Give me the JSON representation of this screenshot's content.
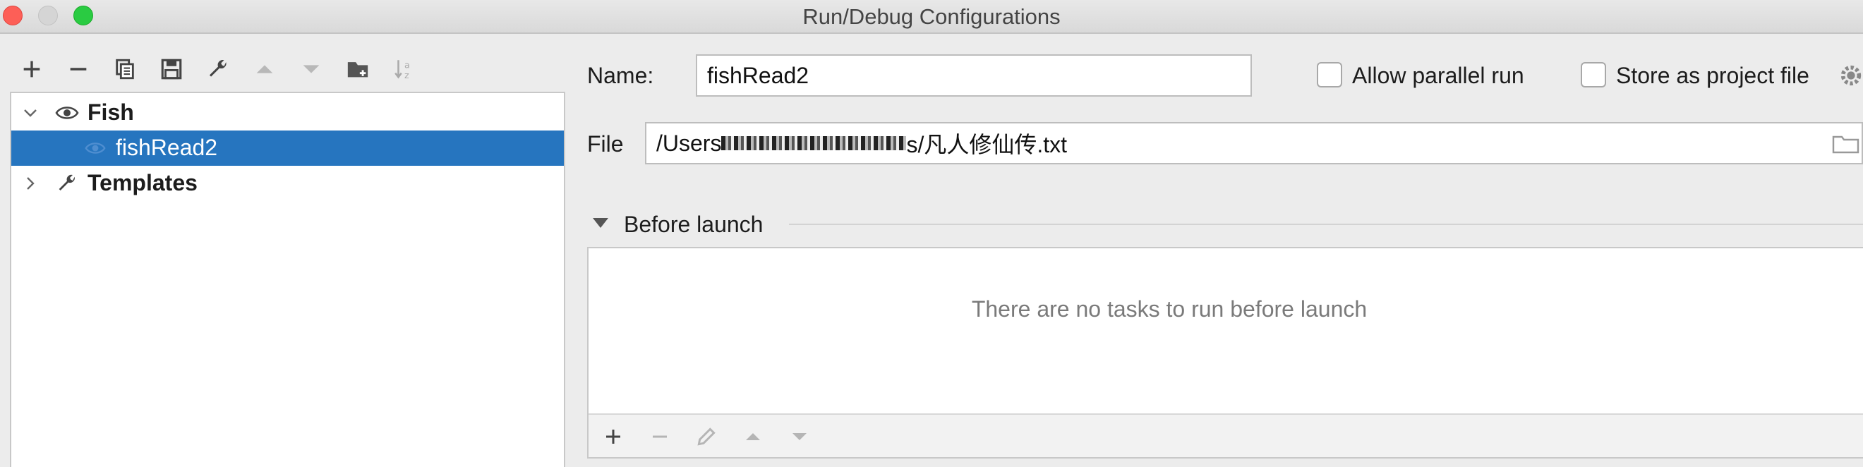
{
  "window": {
    "title": "Run/Debug Configurations"
  },
  "toolbar": {
    "buttons": [
      {
        "name": "add",
        "icon": "plus-icon"
      },
      {
        "name": "remove",
        "icon": "minus-icon"
      },
      {
        "name": "copy",
        "icon": "copy-icon"
      },
      {
        "name": "save",
        "icon": "save-icon"
      },
      {
        "name": "edit-templates",
        "icon": "wrench-icon"
      },
      {
        "name": "move-up",
        "icon": "triangle-up-icon"
      },
      {
        "name": "move-down",
        "icon": "triangle-down-icon"
      },
      {
        "name": "new-folder",
        "icon": "folder-add-icon"
      },
      {
        "name": "sort",
        "icon": "sort-alpha-icon"
      }
    ]
  },
  "tree": {
    "group_label": "Fish",
    "config_label": "fishRead2",
    "templates_label": "Templates"
  },
  "form": {
    "name_label": "Name:",
    "name_value": "fishRead2",
    "allow_parallel_label": "Allow parallel run",
    "store_project_label": "Store as project file",
    "file_label": "File",
    "file_value_prefix": "/Users",
    "file_value_suffix": "s/凡人修仙传.txt"
  },
  "before_launch": {
    "title": "Before launch",
    "empty_message": "There are no tasks to run before launch"
  },
  "colors": {
    "selection": "#2675bf",
    "close": "#fd5f57",
    "zoom": "#2acb42"
  }
}
